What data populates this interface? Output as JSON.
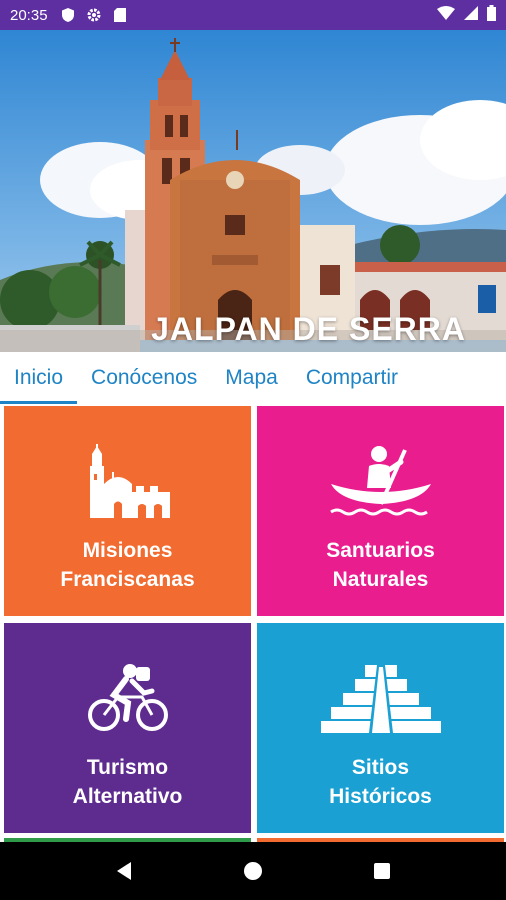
{
  "status_bar": {
    "time": "20:35"
  },
  "hero": {
    "title": "JALPAN DE SERRA"
  },
  "tabs": [
    {
      "label": "Inicio",
      "active": true
    },
    {
      "label": "Conócenos",
      "active": false
    },
    {
      "label": "Mapa",
      "active": false
    },
    {
      "label": "Compartir",
      "active": false
    }
  ],
  "tiles": [
    {
      "label": "Misiones\nFranciscanas",
      "color": "#f26b30",
      "icon": "mission-church-icon"
    },
    {
      "label": "Santuarios\nNaturales",
      "color": "#ea1d8f",
      "icon": "canoe-icon"
    },
    {
      "label": "Turismo\nAlternativo",
      "color": "#5e2c8f",
      "icon": "cyclist-icon"
    },
    {
      "label": "Sitios\nHistóricos",
      "color": "#1aa0d2",
      "icon": "pyramid-icon"
    }
  ],
  "colors": {
    "status_bar": "#5e2fa0",
    "tab_accent": "#1f84c6"
  }
}
